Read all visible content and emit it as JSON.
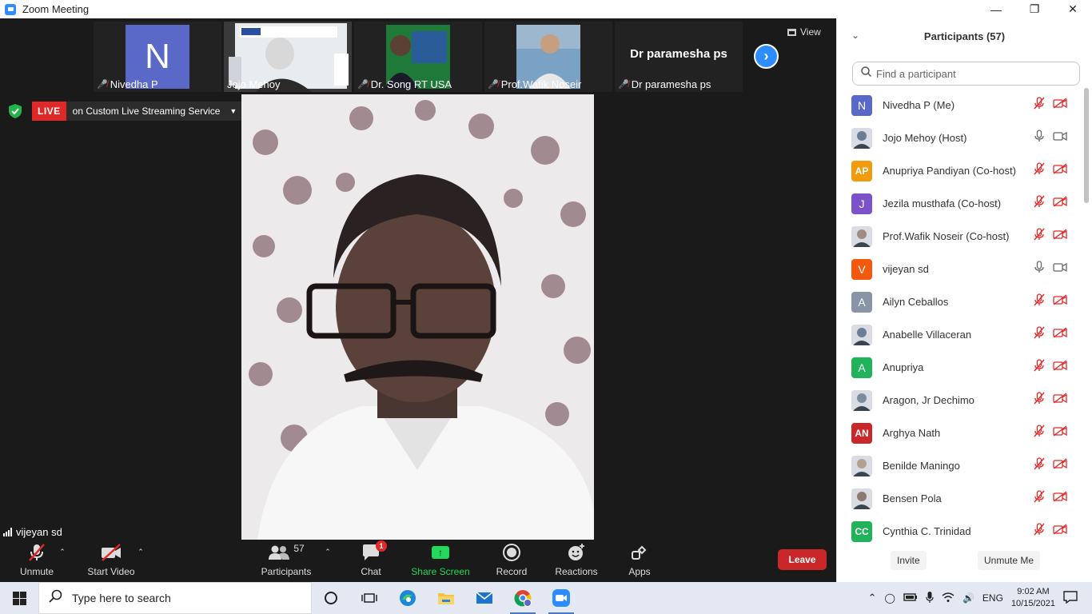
{
  "window": {
    "title": "Zoom Meeting"
  },
  "thumbnails": [
    {
      "name": "Nivedha P",
      "avatar_letter": "N",
      "muted": true
    },
    {
      "name": "Jojo Mehoy",
      "muted": false
    },
    {
      "name": "Dr. Song RT USA",
      "muted": true
    },
    {
      "name": "Prof.Wafik Noseir",
      "muted": true
    },
    {
      "name": "Dr paramesha ps",
      "big_text": "Dr paramesha ps",
      "muted": true
    }
  ],
  "view_label": "View",
  "live": {
    "tag": "LIVE",
    "service": "on Custom Live Streaming Service"
  },
  "active_speaker": {
    "name": "vijeyan sd"
  },
  "toolbar": {
    "unmute": "Unmute",
    "start_video": "Start Video",
    "participants": "Participants",
    "participants_count": "57",
    "chat": "Chat",
    "chat_badge": "1",
    "share_screen": "Share Screen",
    "record": "Record",
    "reactions": "Reactions",
    "apps": "Apps",
    "leave": "Leave"
  },
  "panel": {
    "title": "Participants (57)",
    "search_placeholder": "Find a participant",
    "invite": "Invite",
    "unmute_me": "Unmute Me",
    "participants": [
      {
        "name": "Nivedha P (Me)",
        "initials": "N",
        "color": "#5a68c8",
        "muted": true
      },
      {
        "name": "Jojo Mehoy (Host)",
        "photo": true,
        "muted": false
      },
      {
        "name": "Anupriya Pandiyan (Co-host)",
        "initials": "AP",
        "color": "#f29b0c",
        "muted": true
      },
      {
        "name": "Jezila musthafa (Co-host)",
        "initials": "J",
        "color": "#7b52c9",
        "muted": true
      },
      {
        "name": "Prof.Wafik Noseir (Co-host)",
        "photo": true,
        "muted": true
      },
      {
        "name": "vijeyan sd",
        "initials": "V",
        "color": "#f2590c",
        "muted": false
      },
      {
        "name": "Ailyn Ceballos",
        "initials": "A",
        "color": "#8895a7",
        "muted": true
      },
      {
        "name": "Anabelle Villaceran",
        "photo": true,
        "muted": true
      },
      {
        "name": "Anupriya",
        "initials": "A",
        "color": "#21b35a",
        "muted": true
      },
      {
        "name": "Aragon, Jr Dechimo",
        "photo": true,
        "muted": true
      },
      {
        "name": "Arghya Nath",
        "initials": "AN",
        "color": "#c9272a",
        "muted": true
      },
      {
        "name": "Benilde Maningo",
        "photo": true,
        "muted": true
      },
      {
        "name": "Bensen Pola",
        "photo": true,
        "muted": true
      },
      {
        "name": "Cynthia C. Trinidad",
        "initials": "CC",
        "color": "#21b35a",
        "muted": true
      }
    ]
  },
  "taskbar": {
    "search_placeholder": "Type here to search",
    "language": "ENG",
    "time": "9:02 AM",
    "date": "10/15/2021"
  }
}
